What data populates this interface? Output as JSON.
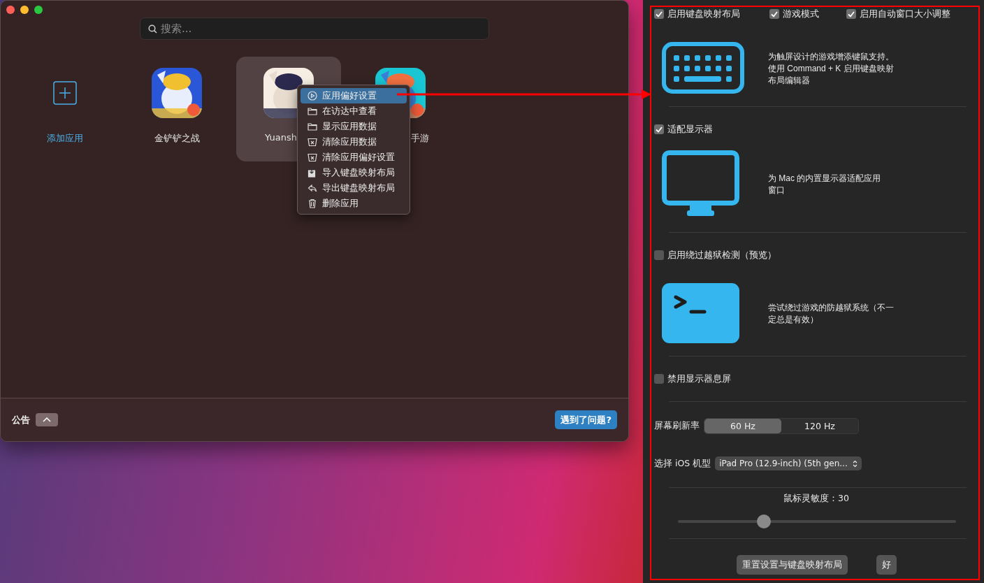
{
  "window": {
    "search": {
      "placeholder": "搜索..."
    },
    "apps": [
      {
        "kind": "add",
        "label": "添加应用",
        "selected": false
      },
      {
        "kind": "game",
        "label": "金铲铲之战",
        "selected": false
      },
      {
        "kind": "game",
        "label": "Yuansh",
        "selected": true
      },
      {
        "kind": "game",
        "label": "手游",
        "selected": false
      }
    ],
    "context_menu": [
      {
        "kind": "preferences",
        "label": "应用偏好设置",
        "selected": true
      },
      {
        "kind": "folder",
        "label": "在访达中查看",
        "selected": false
      },
      {
        "kind": "folder",
        "label": "显示应用数据",
        "selected": false
      },
      {
        "kind": "clear",
        "label": "清除应用数据",
        "selected": false
      },
      {
        "kind": "clear",
        "label": "清除应用偏好设置",
        "selected": false
      },
      {
        "kind": "import",
        "label": "导入键盘映射布局",
        "selected": false
      },
      {
        "kind": "export",
        "label": "导出键盘映射布局",
        "selected": false
      },
      {
        "kind": "delete",
        "label": "删除应用",
        "selected": false
      }
    ],
    "footer": {
      "announcement": "公告",
      "help_button": "遇到了问题?"
    }
  },
  "settings": {
    "top_options": [
      {
        "label": "启用键盘映射布局",
        "checked": true
      },
      {
        "label": "游戏模式",
        "checked": true
      },
      {
        "label": "启用自动窗口大小调整",
        "checked": true
      }
    ],
    "sections": [
      {
        "kind": "keyboard",
        "description": "为触屏设计的游戏增添键鼠支持。使用 Command + K 启用键盘映射布局编辑器"
      },
      {
        "kind": "display",
        "option": {
          "label": "适配显示器",
          "checked": true
        },
        "description": "为 Mac 的内置显示器适配应用窗口"
      },
      {
        "kind": "terminal",
        "option": {
          "label": "启用绕过越狱检测（预览）",
          "checked": false
        },
        "description": "尝试绕过游戏的防越狱系统（不一定总是有效）"
      },
      {
        "kind": "plain",
        "option": {
          "label": "禁用显示器息屏",
          "checked": false
        }
      }
    ],
    "refresh_rate": {
      "label": "屏幕刷新率",
      "options": [
        {
          "label": "60 Hz",
          "selected": true
        },
        {
          "label": "120 Hz",
          "selected": false
        }
      ]
    },
    "device_model": {
      "label": "选择 iOS 机型",
      "value": "iPad Pro (12.9-inch) (5th gen..."
    },
    "mouse_sensitivity": {
      "label": "鼠标灵敏度：30",
      "level": 0.31
    },
    "buttons": [
      "重置设置与键盘映射布局",
      "好"
    ]
  }
}
